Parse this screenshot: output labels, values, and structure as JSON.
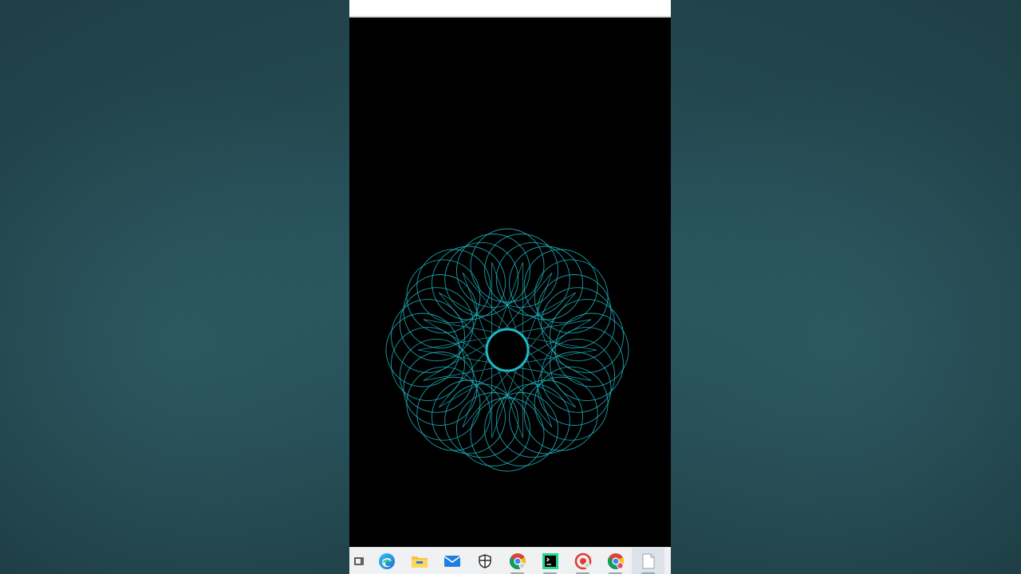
{
  "window": {
    "title": ""
  },
  "canvas": {
    "background": "#000000",
    "stroke_color": "#1fb8c6",
    "pattern": "spirograph"
  },
  "taskbar": {
    "items": [
      {
        "name": "task-view-icon",
        "running": false
      },
      {
        "name": "edge-browser-icon",
        "running": false
      },
      {
        "name": "file-explorer-icon",
        "running": false
      },
      {
        "name": "mail-icon",
        "running": false
      },
      {
        "name": "security-shield-icon",
        "running": false
      },
      {
        "name": "chrome-icon",
        "running": true
      },
      {
        "name": "pycharm-icon",
        "running": true
      },
      {
        "name": "recorder-icon",
        "running": true
      },
      {
        "name": "chrome-profile-icon",
        "running": true
      },
      {
        "name": "notepad-icon",
        "running": true,
        "active": true
      }
    ]
  },
  "colors": {
    "background_teal": "#23474f",
    "taskbar": "#f0f1f3",
    "accent_cyan": "#1fb8c6"
  }
}
